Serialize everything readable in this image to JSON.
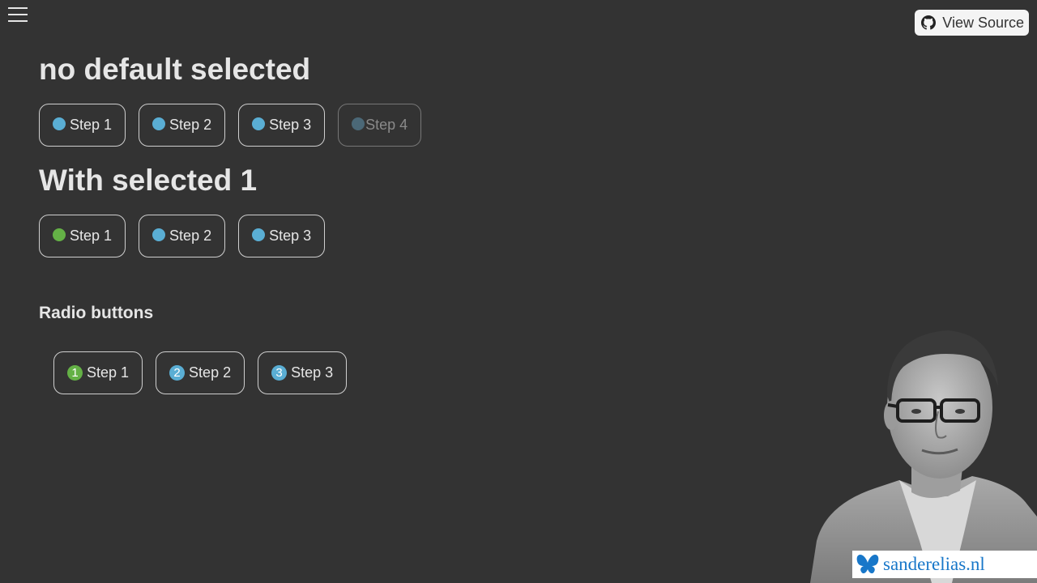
{
  "header": {
    "menu_icon": "hamburger-menu-icon",
    "view_source_label": "View Source",
    "view_source_icon": "github-icon"
  },
  "section_no_default": {
    "title": "no default selected",
    "steps": [
      {
        "label": "Step 1",
        "state": "default",
        "dot_color": "#5aaed4"
      },
      {
        "label": "Step 2",
        "state": "default",
        "dot_color": "#5aaed4"
      },
      {
        "label": "Step 3",
        "state": "default",
        "dot_color": "#5aaed4"
      },
      {
        "label": "Step 4",
        "state": "disabled",
        "dot_color": "#4b6877"
      }
    ]
  },
  "section_selected": {
    "title": "With selected 1",
    "steps": [
      {
        "label": "Step 1",
        "state": "selected",
        "dot_color": "#64b146"
      },
      {
        "label": "Step 2",
        "state": "default",
        "dot_color": "#5aaed4"
      },
      {
        "label": "Step 3",
        "state": "default",
        "dot_color": "#5aaed4"
      }
    ]
  },
  "section_radio": {
    "title": "Radio buttons",
    "steps": [
      {
        "number": "1",
        "label": "Step 1",
        "state": "selected",
        "badge_color": "#64b146"
      },
      {
        "number": "2",
        "label": "Step 2",
        "state": "default",
        "badge_color": "#5aaed4"
      },
      {
        "number": "3",
        "label": "Step 3",
        "state": "default",
        "badge_color": "#5aaed4"
      }
    ]
  },
  "brand": {
    "text": "sanderelias.nl",
    "icon": "butterfly-icon",
    "color": "#1877c9"
  },
  "portrait": {
    "icon": "author-portrait"
  }
}
